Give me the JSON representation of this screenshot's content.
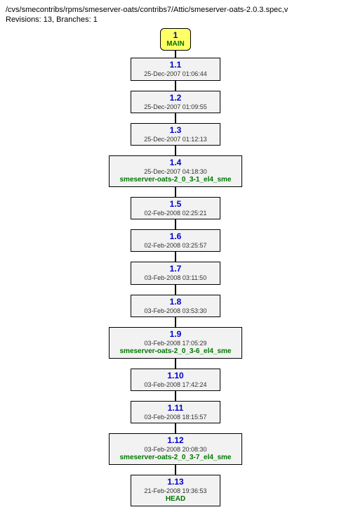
{
  "header": {
    "path": "/cvs/smecontribs/rpms/smeserver-oats/contribs7/Attic/smeserver-oats-2.0.3.spec,v",
    "revisions_line": "Revisions: 13, Branches: 1"
  },
  "branch": {
    "number": "1",
    "name": "MAIN"
  },
  "revisions": [
    {
      "ver": "1.1",
      "ts": "25-Dec-2007 01:06:44",
      "tag": ""
    },
    {
      "ver": "1.2",
      "ts": "25-Dec-2007 01:09:55",
      "tag": ""
    },
    {
      "ver": "1.3",
      "ts": "25-Dec-2007 01:12:13",
      "tag": ""
    },
    {
      "ver": "1.4",
      "ts": "25-Dec-2007 04:18:30",
      "tag": "smeserver-oats-2_0_3-1_el4_sme"
    },
    {
      "ver": "1.5",
      "ts": "02-Feb-2008 02:25:21",
      "tag": ""
    },
    {
      "ver": "1.6",
      "ts": "02-Feb-2008 03:25:57",
      "tag": ""
    },
    {
      "ver": "1.7",
      "ts": "03-Feb-2008 03:11:50",
      "tag": ""
    },
    {
      "ver": "1.8",
      "ts": "03-Feb-2008 03:53:30",
      "tag": ""
    },
    {
      "ver": "1.9",
      "ts": "03-Feb-2008 17:05:29",
      "tag": "smeserver-oats-2_0_3-6_el4_sme"
    },
    {
      "ver": "1.10",
      "ts": "03-Feb-2008 17:42:24",
      "tag": ""
    },
    {
      "ver": "1.11",
      "ts": "03-Feb-2008 18:15:57",
      "tag": ""
    },
    {
      "ver": "1.12",
      "ts": "03-Feb-2008 20:08:30",
      "tag": "smeserver-oats-2_0_3-7_el4_sme"
    },
    {
      "ver": "1.13",
      "ts": "21-Feb-2008 19:36:53",
      "tag": "HEAD"
    }
  ]
}
